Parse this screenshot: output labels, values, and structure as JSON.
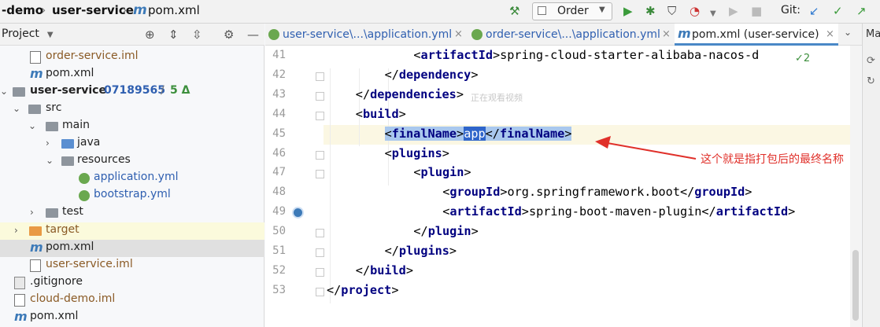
{
  "toolbar": {
    "breadcrumb_project": "-demo",
    "breadcrumb_module": "user-service",
    "breadcrumb_file": "pom.xml",
    "maven_icon": "m",
    "run_config": "Order",
    "git_label": "Git:",
    "icons": [
      "hammer-icon",
      "run-icon",
      "debug-icon",
      "coverage-icon",
      "profile-icon",
      "stop-icon",
      "git-update-icon",
      "git-commit-icon",
      "git-push-icon"
    ]
  },
  "project_panel": {
    "title": "Project",
    "items": [
      {
        "label": "order-service.iml",
        "kind": "iml",
        "color": "brown"
      },
      {
        "label": "pom.xml",
        "kind": "maven",
        "color": "default"
      },
      {
        "label": "user-service",
        "kind": "module",
        "branch": "07189565",
        "changes": "5 Δ"
      },
      {
        "label": "src",
        "kind": "folder"
      },
      {
        "label": "main",
        "kind": "folder"
      },
      {
        "label": "java",
        "kind": "folder-blue"
      },
      {
        "label": "resources",
        "kind": "folder-res"
      },
      {
        "label": "application.yml",
        "kind": "yml",
        "color": "blue"
      },
      {
        "label": "bootstrap.yml",
        "kind": "yml",
        "color": "blue"
      },
      {
        "label": "test",
        "kind": "folder"
      },
      {
        "label": "target",
        "kind": "folder-orange",
        "color": "brown"
      },
      {
        "label": "pom.xml",
        "kind": "maven",
        "color": "default"
      },
      {
        "label": "user-service.iml",
        "kind": "iml",
        "color": "brown"
      },
      {
        "label": ".gitignore",
        "kind": "git",
        "color": "default"
      },
      {
        "label": "cloud-demo.iml",
        "kind": "iml",
        "color": "brown"
      },
      {
        "label": "pom.xml",
        "kind": "maven",
        "color": "default"
      }
    ]
  },
  "tabs": [
    {
      "label": "user-service\\...\\application.yml",
      "active": false
    },
    {
      "label": "order-service\\...\\application.yml",
      "active": false
    },
    {
      "label": "pom.xml (user-service)",
      "active": true
    }
  ],
  "editor": {
    "line_numbers": [
      "41",
      "42",
      "43",
      "44",
      "45",
      "46",
      "47",
      "48",
      "49",
      "50",
      "51",
      "52",
      "53"
    ],
    "lines": [
      {
        "open": "<",
        "name": "artifactId",
        "close": ">",
        "text": "spring-cloud-starter-alibaba-nacos-d"
      },
      {
        "open": "</",
        "name": "dependency",
        "close": ">",
        "text": ""
      },
      {
        "open": "</",
        "name": "dependencies",
        "close": ">",
        "text": ""
      },
      {
        "open": "<",
        "name": "build",
        "close": ">",
        "text": ""
      },
      {
        "open": "<",
        "name": "finalName",
        "close": ">",
        "text": "app",
        "end": "finalName"
      },
      {
        "open": "<",
        "name": "plugins",
        "close": ">",
        "text": ""
      },
      {
        "open": "<",
        "name": "plugin",
        "close": ">",
        "text": ""
      },
      {
        "open": "<",
        "name": "groupId",
        "close": ">",
        "text": "org.springframework.boot",
        "end": "groupId"
      },
      {
        "open": "<",
        "name": "artifactId",
        "close": ">",
        "text": "spring-boot-maven-plugin",
        "end": "artifactId"
      },
      {
        "open": "</",
        "name": "plugin",
        "close": ">",
        "text": ""
      },
      {
        "open": "</",
        "name": "plugins",
        "close": ">",
        "text": ""
      },
      {
        "open": "</",
        "name": "build",
        "close": ">",
        "text": ""
      },
      {
        "open": "</",
        "name": "project",
        "close": ">",
        "text": ""
      }
    ],
    "inspections": "✓2",
    "annotation": "这个就是指打包后的最终名称",
    "watermark": "正在观看视频"
  },
  "right_strip": {
    "label": "Ma"
  },
  "colors": {
    "tag": "#000080",
    "selection": "#a9c8ee",
    "annotation": "#e0302a",
    "active_tab": "#4a88c7"
  }
}
